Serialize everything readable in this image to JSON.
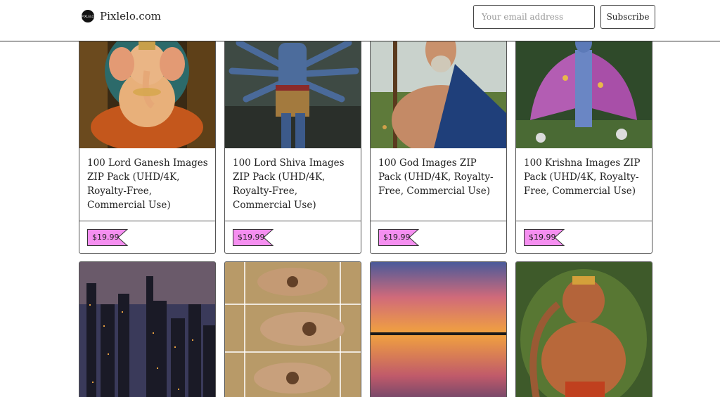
{
  "header": {
    "logo_text": "PIXLELO",
    "site_name": "Pixlelo.com",
    "email_placeholder": "Your email address",
    "subscribe_label": "Subscribe"
  },
  "colors": {
    "price_tag_bg": "#f58ff0",
    "border": "#555555"
  },
  "products": [
    {
      "title": "100 Lord Ganesh Images ZIP Pack (UHD/4K, Royalty-Free, Commercial Use)",
      "price": "$19.99",
      "image": "ganesh-statue"
    },
    {
      "title": "100 Lord Shiva Images ZIP Pack (UHD/4K, Royalty-Free, Commercial Use)",
      "price": "$19.99",
      "image": "shiva-multi-armed"
    },
    {
      "title": "100 God Images ZIP Pack (UHD/4K, Royalty-Free, Commercial Use)",
      "price": "$19.99",
      "image": "bearded-god-with-staff"
    },
    {
      "title": "100 Krishna Images ZIP Pack (UHD/4K, Royalty-Free, Commercial Use)",
      "price": "$19.99",
      "image": "krishna-dancing"
    },
    {
      "image": "city-skyline-night"
    },
    {
      "image": "henna-hands-collage"
    },
    {
      "image": "sunset-lake-reflection"
    },
    {
      "image": "hanuman-warrior"
    }
  ]
}
